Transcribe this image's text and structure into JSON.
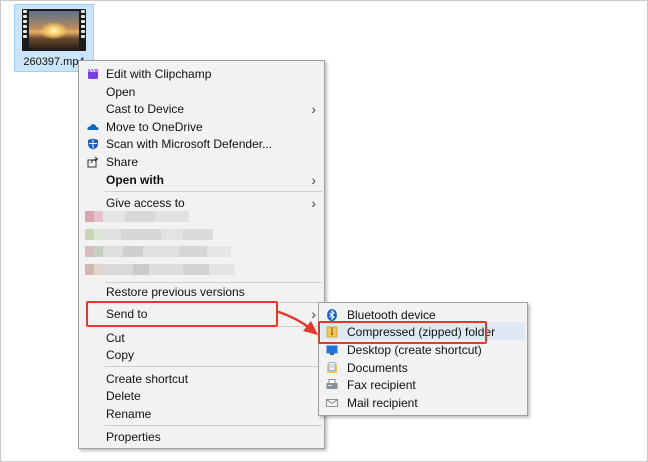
{
  "file": {
    "name": "260397.mp4"
  },
  "main_menu": {
    "items": [
      {
        "label": "Edit with Clipchamp",
        "icon": "clipchamp-icon"
      },
      {
        "label": "Open"
      },
      {
        "label": "Cast to Device",
        "submenu": true
      },
      {
        "label": "Move to OneDrive",
        "icon": "onedrive-icon"
      },
      {
        "label": "Scan with Microsoft Defender...",
        "icon": "defender-icon"
      },
      {
        "label": "Share",
        "icon": "share-icon"
      },
      {
        "label": "Open with",
        "submenu": true
      },
      {
        "label": "Give access to",
        "submenu": true
      },
      {
        "label": "Restore previous versions"
      },
      {
        "label": "Send to",
        "submenu": true
      },
      {
        "label": "Cut"
      },
      {
        "label": "Copy"
      },
      {
        "label": "Create shortcut"
      },
      {
        "label": "Delete"
      },
      {
        "label": "Rename"
      },
      {
        "label": "Properties"
      }
    ]
  },
  "send_to_menu": {
    "items": [
      {
        "label": "Bluetooth device",
        "icon": "bluetooth-icon"
      },
      {
        "label": "Compressed (zipped) folder",
        "icon": "zip-folder-icon"
      },
      {
        "label": "Desktop (create shortcut)",
        "icon": "desktop-icon"
      },
      {
        "label": "Documents",
        "icon": "documents-icon"
      },
      {
        "label": "Fax recipient",
        "icon": "fax-icon"
      },
      {
        "label": "Mail recipient",
        "icon": "mail-icon"
      }
    ]
  },
  "colors": {
    "annotation_red": "#e03a2f",
    "menu_bg": "#f2f2f2",
    "selection_bg": "#cce4f7"
  }
}
